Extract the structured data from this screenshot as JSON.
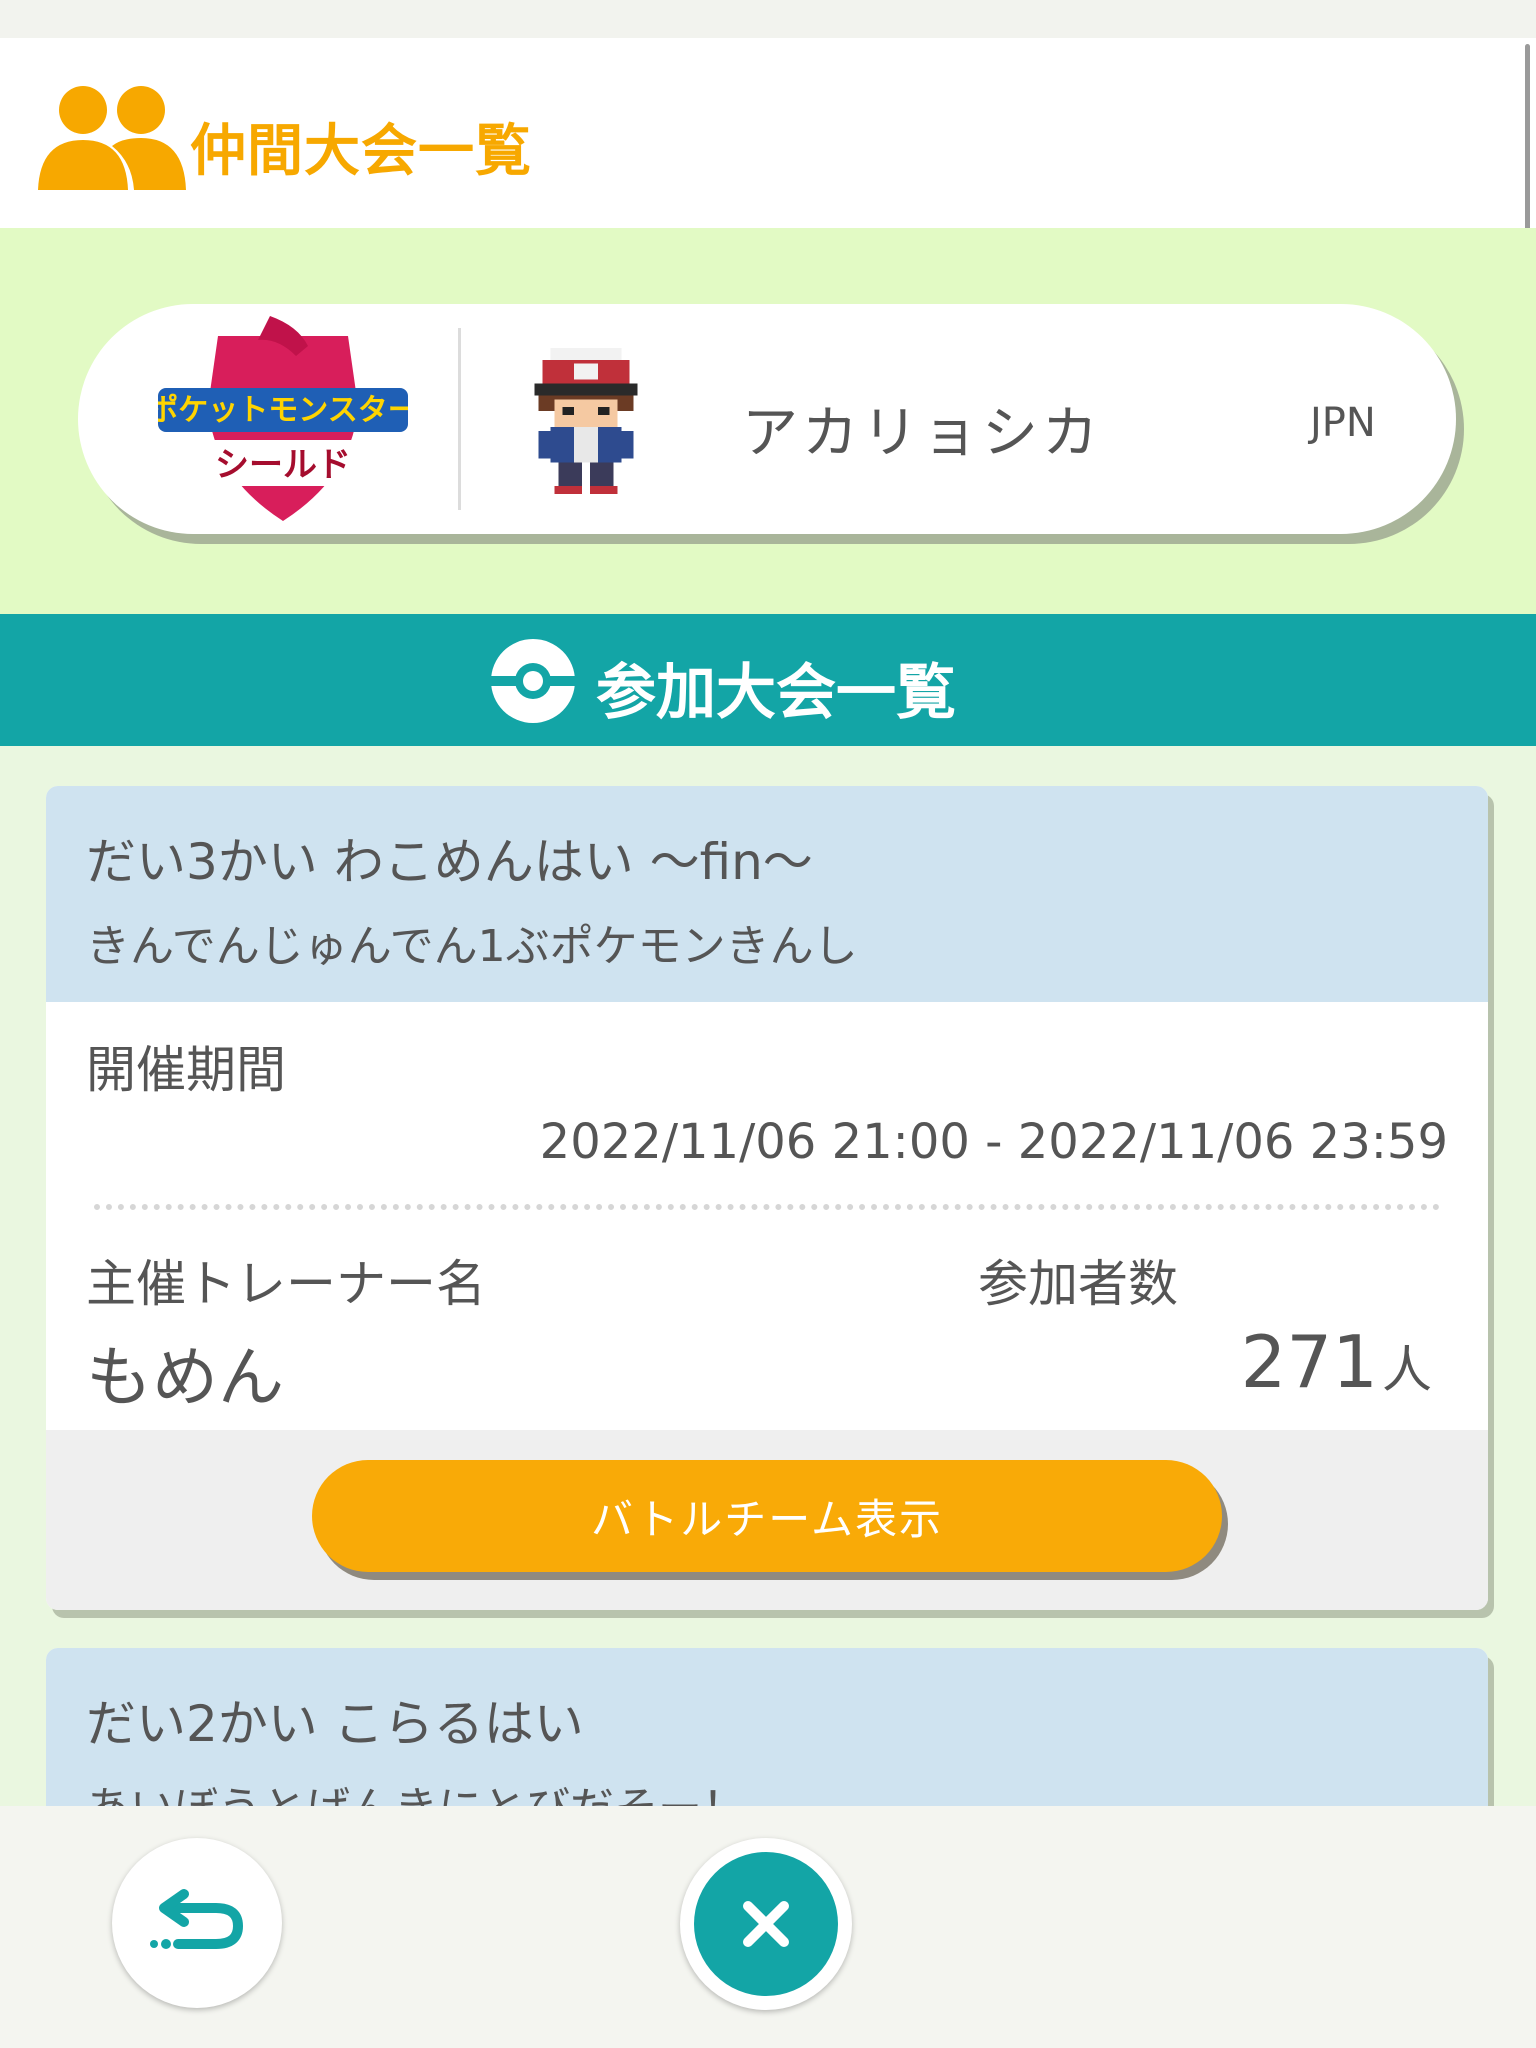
{
  "header": {
    "title": "仲間大会一覧",
    "icon": "friends-icon"
  },
  "profile": {
    "game_logo_line1": "ポケットモンスター",
    "game_logo_line2": "シールド",
    "trainer_name": "アカリョシカ",
    "region": "JPN"
  },
  "section": {
    "title": "参加大会一覧",
    "icon": "pokeball-icon"
  },
  "competitions": [
    {
      "title": "だい3かい わこめんはい 〜fin〜",
      "subtitle": "きんでんじゅんでん1ぶポケモンきんし",
      "period_label": "開催期間",
      "period_value": "2022/11/06 21:00 - 2022/11/06 23:59",
      "organizer_label": "主催トレーナー名",
      "organizer": "もめん",
      "participants_label": "参加者数",
      "participants": "271",
      "participants_unit": "人",
      "button_label": "バトルチーム表示"
    },
    {
      "title": "だい2かい こらるはい",
      "subtitle": "あいぼうとげんきにとびだそー！"
    }
  ],
  "nav": {
    "back_icon": "back-arrow-icon",
    "close_icon": "close-icon"
  },
  "colors": {
    "accent_orange": "#f7a800",
    "teal": "#13a5a6",
    "light_green": "#e2fac4",
    "card_header_blue": "#cfe3f0"
  }
}
